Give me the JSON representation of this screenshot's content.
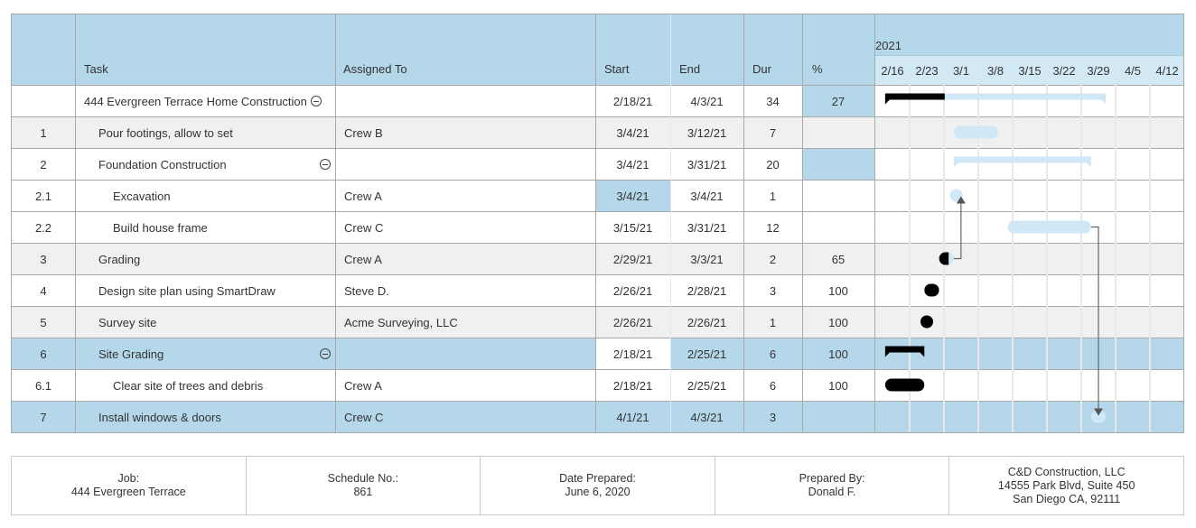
{
  "header": {
    "columns": {
      "num": "",
      "task": "Task",
      "assigned": "Assigned To",
      "start": "Start",
      "end": "End",
      "dur": "Dur",
      "pct": "%"
    },
    "year": "2021",
    "weeks": [
      "2/16",
      "2/23",
      "3/1",
      "3/8",
      "3/15",
      "3/22",
      "3/29",
      "4/5",
      "4/12"
    ]
  },
  "colors": {
    "header_bg": "#b5d7ea",
    "week_header_bg": "#d3e8f5",
    "highlight": "#b5d7ea",
    "alt_row": "#f0f0f0",
    "bar_planned": "#d0e8f6",
    "bar_done": "#000000",
    "arrow": "#666666"
  },
  "rows": [
    {
      "num": "",
      "task": "444 Evergreen Terrace Home Construction",
      "indent": 0,
      "collapsible": true,
      "assigned": "",
      "start": "2/18/21",
      "end": "4/3/21",
      "dur": "34",
      "pct": "27",
      "bg": "white",
      "hl": [
        "pct"
      ]
    },
    {
      "num": "1",
      "task": "Pour footings, allow to set",
      "indent": 1,
      "collapsible": false,
      "assigned": "Crew B",
      "start": "3/4/21",
      "end": "3/12/21",
      "dur": "7",
      "pct": "",
      "bg": "alt",
      "hl": []
    },
    {
      "num": "2",
      "task": "Foundation Construction",
      "indent": 1,
      "collapsible": true,
      "assigned": "",
      "start": "3/4/21",
      "end": "3/31/21",
      "dur": "20",
      "pct": "",
      "bg": "white",
      "hl": [
        "pct"
      ]
    },
    {
      "num": "2.1",
      "task": "Excavation",
      "indent": 2,
      "collapsible": false,
      "assigned": "Crew A",
      "start": "3/4/21",
      "end": "3/4/21",
      "dur": "1",
      "pct": "",
      "bg": "white",
      "hl": [
        "start"
      ]
    },
    {
      "num": "2.2",
      "task": "Build house frame",
      "indent": 2,
      "collapsible": false,
      "assigned": "Crew C",
      "start": "3/15/21",
      "end": "3/31/21",
      "dur": "12",
      "pct": "",
      "bg": "white",
      "hl": []
    },
    {
      "num": "3",
      "task": "Grading",
      "indent": 1,
      "collapsible": false,
      "assigned": "Crew A",
      "start": "2/29/21",
      "end": "3/3/21",
      "dur": "2",
      "pct": "65",
      "bg": "alt",
      "hl": []
    },
    {
      "num": "4",
      "task": "Design site plan using SmartDraw",
      "indent": 1,
      "collapsible": false,
      "assigned": "Steve D.",
      "start": "2/26/21",
      "end": "2/28/21",
      "dur": "3",
      "pct": "100",
      "bg": "white",
      "hl": []
    },
    {
      "num": "5",
      "task": "Survey site",
      "indent": 1,
      "collapsible": false,
      "assigned": "Acme Surveying, LLC",
      "start": "2/26/21",
      "end": "2/26/21",
      "dur": "1",
      "pct": "100",
      "bg": "alt",
      "hl": []
    },
    {
      "num": "6",
      "task": "Site Grading",
      "indent": 1,
      "collapsible": true,
      "assigned": "",
      "start": "2/18/21",
      "end": "2/25/21",
      "dur": "6",
      "pct": "100",
      "bg": "blue",
      "hl": [],
      "white": [
        "start"
      ]
    },
    {
      "num": "6.1",
      "task": "Clear site of trees and debris",
      "indent": 2,
      "collapsible": false,
      "assigned": "Crew A",
      "start": "2/18/21",
      "end": "2/25/21",
      "dur": "6",
      "pct": "100",
      "bg": "white",
      "hl": []
    },
    {
      "num": "7",
      "task": "Install windows & doors",
      "indent": 1,
      "collapsible": false,
      "assigned": "Crew C",
      "start": "4/1/21",
      "end": "4/3/21",
      "dur": "3",
      "pct": "",
      "bg": "blue",
      "hl": []
    }
  ],
  "chart_data": {
    "type": "gantt",
    "title": "",
    "axis_start": "2021-02-16",
    "axis_ticks": [
      "2/16",
      "2/23",
      "3/1",
      "3/8",
      "3/15",
      "3/22",
      "3/29",
      "4/5",
      "4/12"
    ],
    "tasks": [
      {
        "id": "",
        "name": "444 Evergreen Terrace Home Construction",
        "kind": "summary",
        "start": "2021-02-18",
        "end": "2021-04-03",
        "progress": 27
      },
      {
        "id": "1",
        "name": "Pour footings, allow to set",
        "kind": "task",
        "start": "2021-03-04",
        "end": "2021-03-12",
        "progress": 0
      },
      {
        "id": "2",
        "name": "Foundation Construction",
        "kind": "summary",
        "start": "2021-03-04",
        "end": "2021-03-31",
        "progress": 0
      },
      {
        "id": "2.1",
        "name": "Excavation",
        "kind": "task",
        "start": "2021-03-04",
        "end": "2021-03-04",
        "progress": 0
      },
      {
        "id": "2.2",
        "name": "Build house frame",
        "kind": "task",
        "start": "2021-03-15",
        "end": "2021-03-31",
        "progress": 0
      },
      {
        "id": "3",
        "name": "Grading",
        "kind": "task",
        "start": "2021-03-01",
        "end": "2021-03-03",
        "progress": 65
      },
      {
        "id": "4",
        "name": "Design site plan using SmartDraw",
        "kind": "task",
        "start": "2021-02-26",
        "end": "2021-02-28",
        "progress": 100
      },
      {
        "id": "5",
        "name": "Survey site",
        "kind": "task",
        "start": "2021-02-26",
        "end": "2021-02-26",
        "progress": 100
      },
      {
        "id": "6",
        "name": "Site Grading",
        "kind": "summary",
        "start": "2021-02-18",
        "end": "2021-02-25",
        "progress": 100
      },
      {
        "id": "6.1",
        "name": "Clear site of trees and debris",
        "kind": "task",
        "start": "2021-02-18",
        "end": "2021-02-25",
        "progress": 100
      },
      {
        "id": "7",
        "name": "Install windows & doors",
        "kind": "task",
        "start": "2021-04-01",
        "end": "2021-04-03",
        "progress": 0
      }
    ],
    "dependencies": [
      {
        "from": "3",
        "to": "2.1"
      },
      {
        "from": "2.2",
        "to": "7"
      }
    ]
  },
  "footer": [
    {
      "label": "Job:",
      "value": "444 Evergreen Terrace"
    },
    {
      "label": "Schedule No.:",
      "value": "861"
    },
    {
      "label": "Date Prepared:",
      "value": "June 6, 2020"
    },
    {
      "label": "Prepared By:",
      "value": "Donald F."
    },
    {
      "lines": [
        "C&D Construction, LLC",
        "14555 Park Blvd, Suite 450",
        "San Diego CA, 92111"
      ]
    }
  ]
}
